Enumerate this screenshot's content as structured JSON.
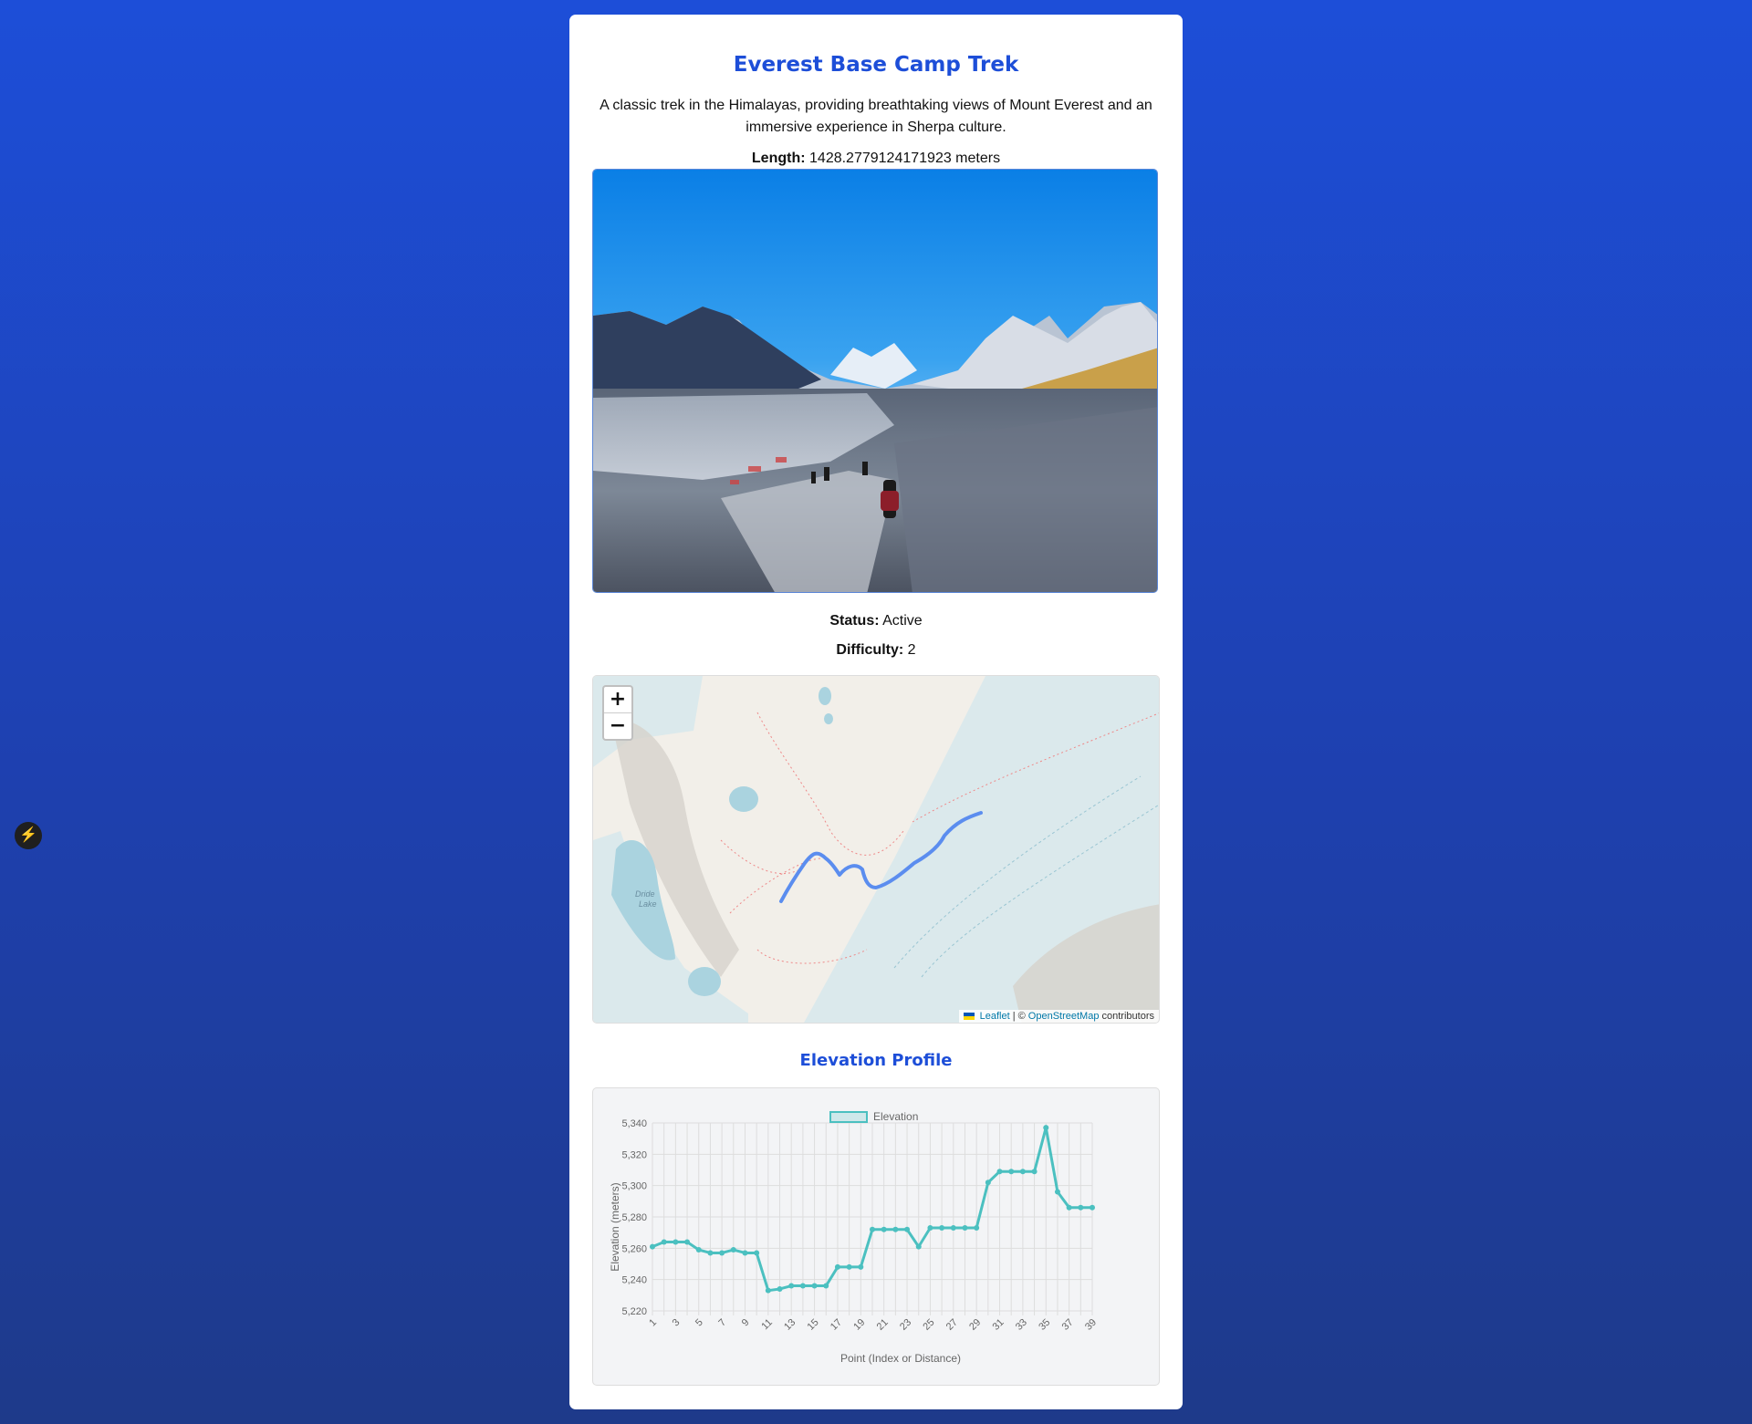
{
  "trail": {
    "title": "Everest Base Camp Trek",
    "description": "A classic trek in the Himalayas, providing breathtaking views of Mount Everest and an immersive experience in Sherpa culture.",
    "length_label": "Length:",
    "length_value": "1428.2779124171923 meters",
    "status_label": "Status:",
    "status_value": "Active",
    "difficulty_label": "Difficulty:",
    "difficulty_value": "2"
  },
  "map": {
    "zoom_in": "+",
    "zoom_out": "−",
    "lake_label_1": "Dride",
    "lake_label_2": "Lake",
    "attribution_leaflet": "Leaflet",
    "attribution_sep": "| ©",
    "attribution_osm": "OpenStreetMap",
    "attribution_tail": "contributors",
    "route_color": "#5b8def"
  },
  "elevation_heading": "Elevation Profile",
  "chart_data": {
    "type": "line",
    "legend": "Elevation",
    "xlabel": "Point (Index or Distance)",
    "ylabel": "Elevation (meters)",
    "ylim": [
      5220,
      5340
    ],
    "yticks": [
      "5,340",
      "5,320",
      "5,300",
      "5,280",
      "5,260",
      "5,240",
      "5,220"
    ],
    "x": [
      1,
      2,
      3,
      4,
      5,
      6,
      7,
      8,
      9,
      10,
      11,
      12,
      13,
      14,
      15,
      16,
      17,
      18,
      19,
      20,
      21,
      22,
      23,
      24,
      25,
      26,
      27,
      28,
      29,
      30,
      31,
      32,
      33,
      34,
      35,
      36,
      37,
      38,
      39
    ],
    "xticks": [
      "1",
      "3",
      "5",
      "7",
      "9",
      "11",
      "13",
      "15",
      "17",
      "19",
      "21",
      "23",
      "25",
      "27",
      "29",
      "31",
      "33",
      "35",
      "37",
      "39"
    ],
    "values": [
      5261,
      5264,
      5264,
      5264,
      5259,
      5257,
      5257,
      5259,
      5257,
      5257,
      5233,
      5234,
      5236,
      5236,
      5236,
      5236,
      5248,
      5248,
      5248,
      5272,
      5272,
      5272,
      5272,
      5261,
      5273,
      5273,
      5273,
      5273,
      5273,
      5302,
      5309,
      5309,
      5309,
      5309,
      5337,
      5296,
      5286,
      5286,
      5286
    ],
    "color": "#4bc0c0",
    "grid": true,
    "legend_position": "top"
  }
}
